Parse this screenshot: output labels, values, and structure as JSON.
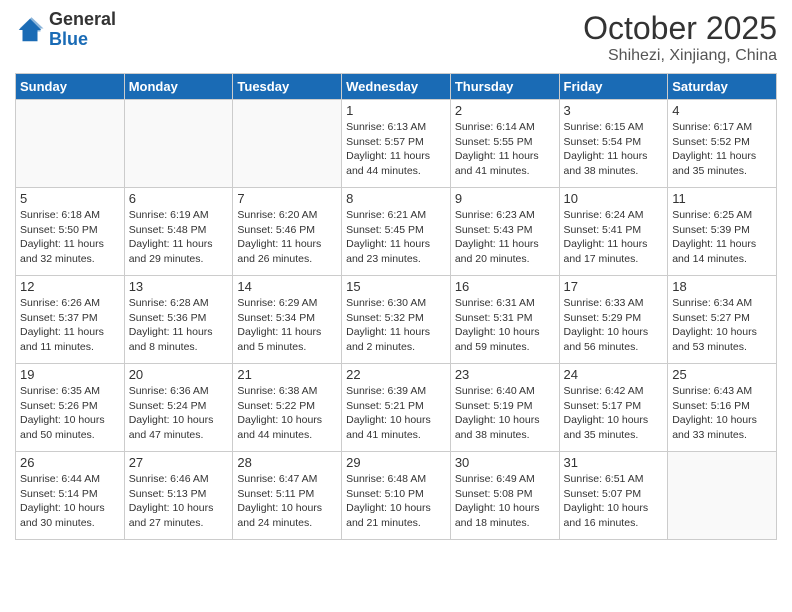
{
  "header": {
    "logo_general": "General",
    "logo_blue": "Blue",
    "month_title": "October 2025",
    "location": "Shihezi, Xinjiang, China"
  },
  "days_of_week": [
    "Sunday",
    "Monday",
    "Tuesday",
    "Wednesday",
    "Thursday",
    "Friday",
    "Saturday"
  ],
  "weeks": [
    [
      {
        "day": "",
        "info": ""
      },
      {
        "day": "",
        "info": ""
      },
      {
        "day": "",
        "info": ""
      },
      {
        "day": "1",
        "info": "Sunrise: 6:13 AM\nSunset: 5:57 PM\nDaylight: 11 hours\nand 44 minutes."
      },
      {
        "day": "2",
        "info": "Sunrise: 6:14 AM\nSunset: 5:55 PM\nDaylight: 11 hours\nand 41 minutes."
      },
      {
        "day": "3",
        "info": "Sunrise: 6:15 AM\nSunset: 5:54 PM\nDaylight: 11 hours\nand 38 minutes."
      },
      {
        "day": "4",
        "info": "Sunrise: 6:17 AM\nSunset: 5:52 PM\nDaylight: 11 hours\nand 35 minutes."
      }
    ],
    [
      {
        "day": "5",
        "info": "Sunrise: 6:18 AM\nSunset: 5:50 PM\nDaylight: 11 hours\nand 32 minutes."
      },
      {
        "day": "6",
        "info": "Sunrise: 6:19 AM\nSunset: 5:48 PM\nDaylight: 11 hours\nand 29 minutes."
      },
      {
        "day": "7",
        "info": "Sunrise: 6:20 AM\nSunset: 5:46 PM\nDaylight: 11 hours\nand 26 minutes."
      },
      {
        "day": "8",
        "info": "Sunrise: 6:21 AM\nSunset: 5:45 PM\nDaylight: 11 hours\nand 23 minutes."
      },
      {
        "day": "9",
        "info": "Sunrise: 6:23 AM\nSunset: 5:43 PM\nDaylight: 11 hours\nand 20 minutes."
      },
      {
        "day": "10",
        "info": "Sunrise: 6:24 AM\nSunset: 5:41 PM\nDaylight: 11 hours\nand 17 minutes."
      },
      {
        "day": "11",
        "info": "Sunrise: 6:25 AM\nSunset: 5:39 PM\nDaylight: 11 hours\nand 14 minutes."
      }
    ],
    [
      {
        "day": "12",
        "info": "Sunrise: 6:26 AM\nSunset: 5:37 PM\nDaylight: 11 hours\nand 11 minutes."
      },
      {
        "day": "13",
        "info": "Sunrise: 6:28 AM\nSunset: 5:36 PM\nDaylight: 11 hours\nand 8 minutes."
      },
      {
        "day": "14",
        "info": "Sunrise: 6:29 AM\nSunset: 5:34 PM\nDaylight: 11 hours\nand 5 minutes."
      },
      {
        "day": "15",
        "info": "Sunrise: 6:30 AM\nSunset: 5:32 PM\nDaylight: 11 hours\nand 2 minutes."
      },
      {
        "day": "16",
        "info": "Sunrise: 6:31 AM\nSunset: 5:31 PM\nDaylight: 10 hours\nand 59 minutes."
      },
      {
        "day": "17",
        "info": "Sunrise: 6:33 AM\nSunset: 5:29 PM\nDaylight: 10 hours\nand 56 minutes."
      },
      {
        "day": "18",
        "info": "Sunrise: 6:34 AM\nSunset: 5:27 PM\nDaylight: 10 hours\nand 53 minutes."
      }
    ],
    [
      {
        "day": "19",
        "info": "Sunrise: 6:35 AM\nSunset: 5:26 PM\nDaylight: 10 hours\nand 50 minutes."
      },
      {
        "day": "20",
        "info": "Sunrise: 6:36 AM\nSunset: 5:24 PM\nDaylight: 10 hours\nand 47 minutes."
      },
      {
        "day": "21",
        "info": "Sunrise: 6:38 AM\nSunset: 5:22 PM\nDaylight: 10 hours\nand 44 minutes."
      },
      {
        "day": "22",
        "info": "Sunrise: 6:39 AM\nSunset: 5:21 PM\nDaylight: 10 hours\nand 41 minutes."
      },
      {
        "day": "23",
        "info": "Sunrise: 6:40 AM\nSunset: 5:19 PM\nDaylight: 10 hours\nand 38 minutes."
      },
      {
        "day": "24",
        "info": "Sunrise: 6:42 AM\nSunset: 5:17 PM\nDaylight: 10 hours\nand 35 minutes."
      },
      {
        "day": "25",
        "info": "Sunrise: 6:43 AM\nSunset: 5:16 PM\nDaylight: 10 hours\nand 33 minutes."
      }
    ],
    [
      {
        "day": "26",
        "info": "Sunrise: 6:44 AM\nSunset: 5:14 PM\nDaylight: 10 hours\nand 30 minutes."
      },
      {
        "day": "27",
        "info": "Sunrise: 6:46 AM\nSunset: 5:13 PM\nDaylight: 10 hours\nand 27 minutes."
      },
      {
        "day": "28",
        "info": "Sunrise: 6:47 AM\nSunset: 5:11 PM\nDaylight: 10 hours\nand 24 minutes."
      },
      {
        "day": "29",
        "info": "Sunrise: 6:48 AM\nSunset: 5:10 PM\nDaylight: 10 hours\nand 21 minutes."
      },
      {
        "day": "30",
        "info": "Sunrise: 6:49 AM\nSunset: 5:08 PM\nDaylight: 10 hours\nand 18 minutes."
      },
      {
        "day": "31",
        "info": "Sunrise: 6:51 AM\nSunset: 5:07 PM\nDaylight: 10 hours\nand 16 minutes."
      },
      {
        "day": "",
        "info": ""
      }
    ]
  ]
}
